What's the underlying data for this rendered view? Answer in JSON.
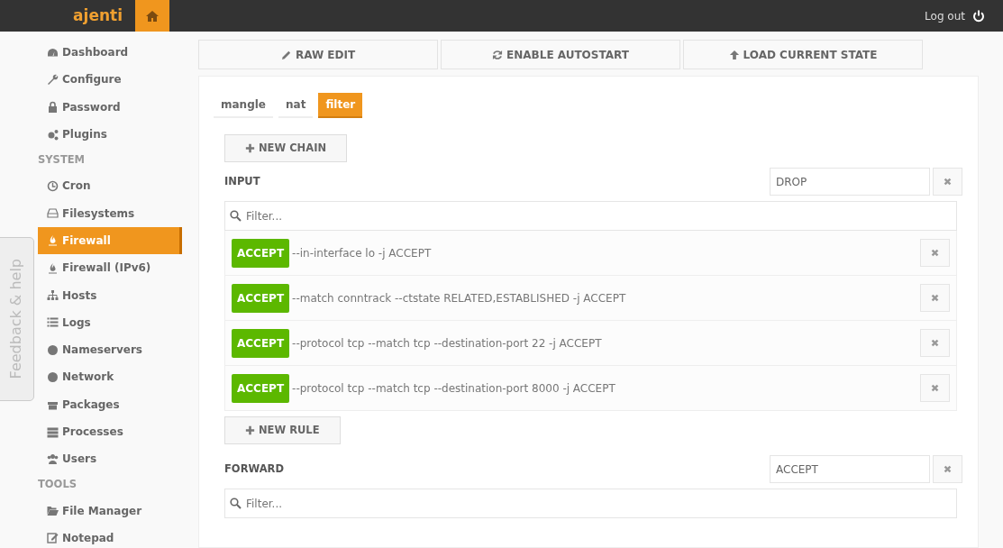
{
  "header": {
    "brand": "ajenti",
    "logout": "Log out"
  },
  "feedback": "Feedback & help",
  "sidebar": {
    "items": [
      {
        "kind": "item",
        "label": "Dashboard",
        "selected": false
      },
      {
        "kind": "item",
        "label": "Configure",
        "selected": false
      },
      {
        "kind": "item",
        "label": "Password",
        "selected": false
      },
      {
        "kind": "item",
        "label": "Plugins",
        "selected": false
      },
      {
        "kind": "header",
        "label": "SYSTEM"
      },
      {
        "kind": "item",
        "label": "Cron",
        "selected": false
      },
      {
        "kind": "item",
        "label": "Filesystems",
        "selected": false
      },
      {
        "kind": "item",
        "label": "Firewall",
        "selected": true
      },
      {
        "kind": "item",
        "label": "Firewall (IPv6)",
        "selected": false
      },
      {
        "kind": "item",
        "label": "Hosts",
        "selected": false
      },
      {
        "kind": "item",
        "label": "Logs",
        "selected": false
      },
      {
        "kind": "item",
        "label": "Nameservers",
        "selected": false
      },
      {
        "kind": "item",
        "label": "Network",
        "selected": false
      },
      {
        "kind": "item",
        "label": "Packages",
        "selected": false
      },
      {
        "kind": "item",
        "label": "Processes",
        "selected": false
      },
      {
        "kind": "item",
        "label": "Users",
        "selected": false
      },
      {
        "kind": "header",
        "label": "TOOLS"
      },
      {
        "kind": "item",
        "label": "File Manager",
        "selected": false
      },
      {
        "kind": "item",
        "label": "Notepad",
        "selected": false
      }
    ]
  },
  "toolbar": [
    "RAW EDIT",
    "ENABLE AUTOSTART",
    "LOAD CURRENT STATE"
  ],
  "tabs": [
    {
      "label": "mangle",
      "selected": false
    },
    {
      "label": "nat",
      "selected": false
    },
    {
      "label": "filter",
      "selected": true
    }
  ],
  "new_chain": "NEW CHAIN",
  "chains": [
    {
      "name": "INPUT",
      "policy": "DROP",
      "filter_placeholder": "Filter...",
      "rules": [
        {
          "target": "ACCEPT",
          "text": "--in-interface lo -j ACCEPT"
        },
        {
          "target": "ACCEPT",
          "text": "--match conntrack --ctstate RELATED,ESTABLISHED -j ACCEPT"
        },
        {
          "target": "ACCEPT",
          "text": "--protocol tcp --match tcp --destination-port 22 -j ACCEPT"
        },
        {
          "target": "ACCEPT",
          "text": "--protocol tcp --match tcp --destination-port 8000 -j ACCEPT"
        }
      ],
      "new_rule": "NEW RULE"
    },
    {
      "name": "FORWARD",
      "policy": "ACCEPT",
      "filter_placeholder": "Filter..."
    }
  ]
}
